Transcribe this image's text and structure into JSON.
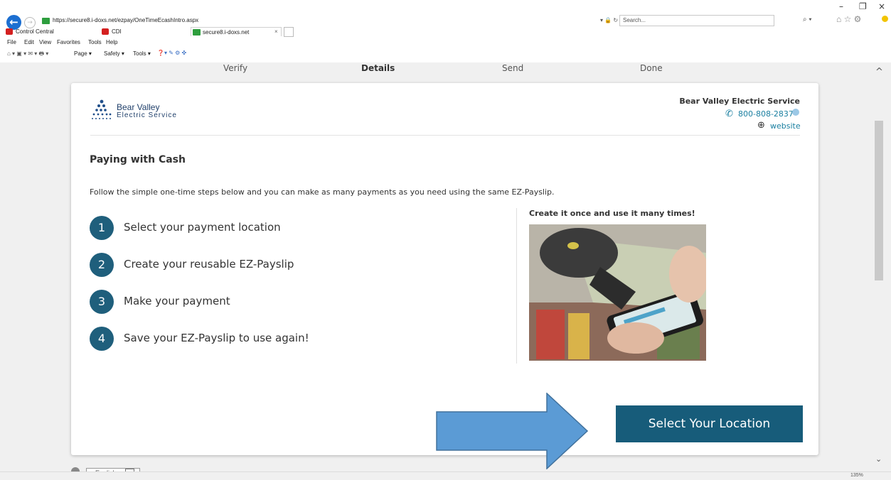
{
  "browser": {
    "url": "https://secure8.i-doxs.net/ezpay/OneTimeEcashIntro.aspx",
    "search_placeholder": "Search...",
    "tabs": [
      {
        "label": "Control Central"
      },
      {
        "label": "CDI"
      },
      {
        "label": "secure8.i-doxs.net"
      }
    ],
    "menu": [
      "File",
      "Edit",
      "View",
      "Favorites",
      "Tools",
      "Help"
    ],
    "toolbar": {
      "page": "Page ▾",
      "safety": "Safety ▾",
      "tools": "Tools ▾"
    },
    "zoom": "135%"
  },
  "steps": [
    "Verify",
    "Details",
    "Send",
    "Done"
  ],
  "biller": {
    "logo_line1": "Bear Valley",
    "logo_line2": "Electric Service",
    "name": "Bear Valley Electric Service",
    "phone": "800-808-2837",
    "website": "website"
  },
  "content": {
    "heading": "Paying with Cash",
    "intro": "Follow the simple one-time steps below and you can make as many payments as you need using the same EZ-Payslip.",
    "steps": [
      {
        "num": "1",
        "text": "Select your payment location"
      },
      {
        "num": "2",
        "text": "Create your reusable EZ-Payslip"
      },
      {
        "num": "3",
        "text": "Make your payment"
      },
      {
        "num": "4",
        "text": "Save your EZ-Payslip to use again!"
      }
    ],
    "promo_title": "Create it once and use it many times!",
    "button": "Select Your Location"
  },
  "footer": {
    "language": "English"
  },
  "colors": {
    "accent": "#175c7a",
    "step_circle": "#1f5f7c",
    "arrow": "#5b9bd5"
  }
}
